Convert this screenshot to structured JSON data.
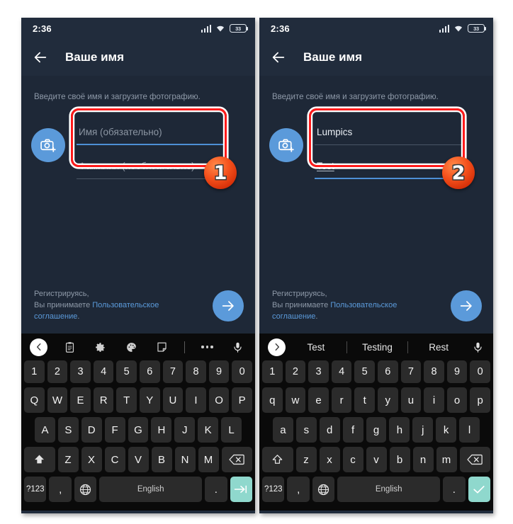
{
  "panels": [
    {
      "id": "step1",
      "status": {
        "time": "2:36",
        "battery": "33"
      },
      "appbar": {
        "title": "Ваше имя",
        "back_icon": "back-arrow-icon"
      },
      "hint": "Введите своё имя и загрузите фотографию.",
      "avatar": {
        "icon": "camera-add-icon"
      },
      "fields": [
        {
          "name": "first-name",
          "value": "Имя (обязательно)",
          "is_placeholder": true,
          "focused": true,
          "underlined_text": false
        },
        {
          "name": "last-name",
          "value": "Фамилия (необязательно)",
          "is_placeholder": true,
          "focused": false,
          "underlined_text": false
        }
      ],
      "badge": "1",
      "footer": {
        "line1": "Регистрируясь,",
        "line2_prefix": "Вы принимаете ",
        "link1": "Пользовательское",
        "link2": "соглашение",
        "period": ".",
        "next_icon": "arrow-right-icon"
      },
      "keyboard": {
        "toolbar_type": "icons",
        "toolbar_icons": [
          "chevron-left-icon",
          "clipboard-icon",
          "gear-icon",
          "palette-icon",
          "sticker-icon",
          "divider",
          "more-dots-icon",
          "microphone-icon"
        ],
        "row1": [
          "1",
          "2",
          "3",
          "4",
          "5",
          "6",
          "7",
          "8",
          "9",
          "0"
        ],
        "row2": [
          "Q",
          "W",
          "E",
          "R",
          "T",
          "Y",
          "U",
          "I",
          "O",
          "P"
        ],
        "row3": [
          "A",
          "S",
          "D",
          "F",
          "G",
          "H",
          "J",
          "K",
          "L"
        ],
        "row4": {
          "shift": "shift-filled-icon",
          "keys": [
            "Z",
            "X",
            "C",
            "V",
            "B",
            "N",
            "M"
          ],
          "backspace": "backspace-icon"
        },
        "row5": {
          "symbols": "?123",
          "comma": ",",
          "globe": "globe-icon",
          "space": "English",
          "period": ".",
          "action": "tab-next-icon"
        }
      }
    },
    {
      "id": "step2",
      "status": {
        "time": "2:36",
        "battery": "33"
      },
      "appbar": {
        "title": "Ваше имя",
        "back_icon": "back-arrow-icon"
      },
      "hint": "Введите своё имя и загрузите фотографию.",
      "avatar": {
        "icon": "camera-add-icon"
      },
      "fields": [
        {
          "name": "first-name",
          "value": "Lumpics",
          "is_placeholder": false,
          "focused": false,
          "underlined_text": false
        },
        {
          "name": "last-name",
          "value": "Test",
          "is_placeholder": false,
          "focused": true,
          "underlined_text": true
        }
      ],
      "badge": "2",
      "footer": {
        "line1": "Регистрируясь,",
        "line2_prefix": "Вы принимаете ",
        "link1": "Пользовательское",
        "link2": "соглашение",
        "period": ".",
        "next_icon": "arrow-right-icon"
      },
      "keyboard": {
        "toolbar_type": "suggestions",
        "suggestions": [
          "Test",
          "Testing",
          "Rest"
        ],
        "toolbar_icons": [
          "chevron-right-icon",
          "microphone-icon"
        ],
        "row1": [
          "1",
          "2",
          "3",
          "4",
          "5",
          "6",
          "7",
          "8",
          "9",
          "0"
        ],
        "row2": [
          "q",
          "w",
          "e",
          "r",
          "t",
          "y",
          "u",
          "i",
          "o",
          "p"
        ],
        "row3": [
          "a",
          "s",
          "d",
          "f",
          "g",
          "h",
          "j",
          "k",
          "l"
        ],
        "row4": {
          "shift": "shift-outline-icon",
          "keys": [
            "z",
            "x",
            "c",
            "v",
            "b",
            "n",
            "m"
          ],
          "backspace": "backspace-icon"
        },
        "row5": {
          "symbols": "?123",
          "comma": ",",
          "globe": "globe-icon",
          "space": "English",
          "period": ".",
          "action": "checkmark-icon"
        }
      }
    }
  ],
  "colors": {
    "app_bg": "#212c3c",
    "body_bg": "#1e2837",
    "accent_blue": "#5b9ada",
    "highlight_red": "#ff1a1a",
    "key_accent": "#8fd8cd"
  }
}
